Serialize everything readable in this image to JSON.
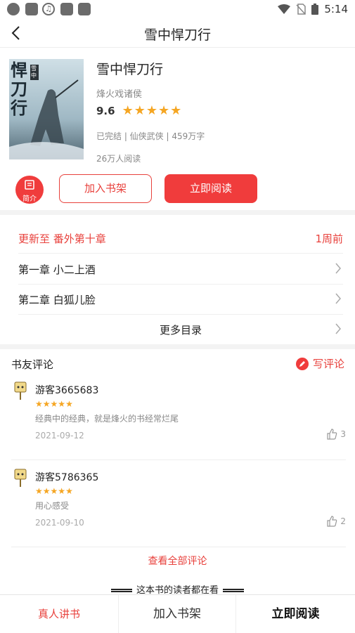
{
  "status_bar": {
    "time": "5:14"
  },
  "header": {
    "title": "雪中悍刀行"
  },
  "book": {
    "title": "雪中悍刀行",
    "author": "烽火戏诸侯",
    "score": "9.6",
    "stars": 5,
    "meta": "已完结 | 仙侠武侠 | 459万字",
    "readers": "26万人阅读",
    "cover_text": "悍刀行",
    "cover_side": "雪中"
  },
  "actions": {
    "intro": "简介",
    "add_shelf": "加入书架",
    "read_now": "立即阅读"
  },
  "chapters": {
    "update_label": "更新至 番外第十章",
    "update_time": "1周前",
    "items": [
      "第一章 小二上酒",
      "第二章 白狐儿脸"
    ],
    "more": "更多目录"
  },
  "comments": {
    "title": "书友评论",
    "write": "写评论",
    "items": [
      {
        "user": "游客3665683",
        "stars": 5,
        "text": "经典中的经典，就是烽火的书经常烂尾",
        "date": "2021-09-12",
        "likes": "3"
      },
      {
        "user": "游客5786365",
        "stars": 5,
        "text": "用心感受",
        "date": "2021-09-10",
        "likes": "2"
      }
    ],
    "view_all": "查看全部评论"
  },
  "also_reading": "这本书的读者都在看",
  "bottom_bar": {
    "audio": "真人讲书",
    "shelf": "加入书架",
    "read": "立即阅读"
  },
  "colors": {
    "accent": "#f03c3c",
    "star": "#f5a623"
  }
}
